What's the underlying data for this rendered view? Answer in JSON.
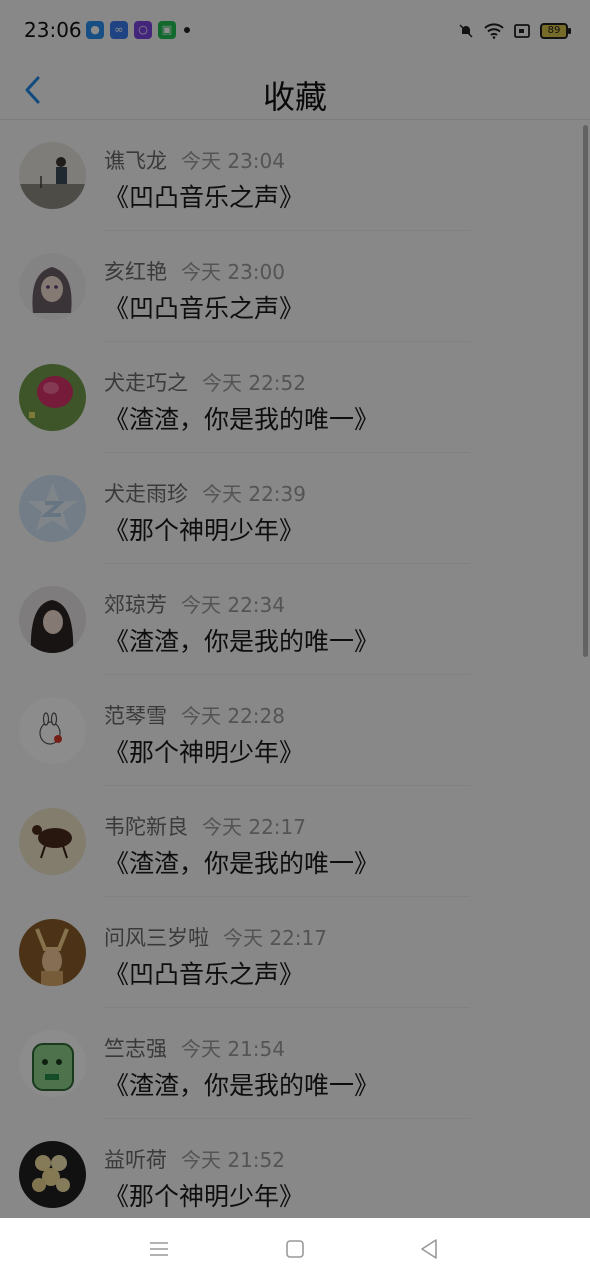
{
  "status_bar": {
    "time": "23:06",
    "battery": "89"
  },
  "header": {
    "title": "收藏"
  },
  "favorites": [
    {
      "name": "谯飞龙",
      "time": "今天 23:04",
      "title": "《凹凸音乐之声》"
    },
    {
      "name": "亥红艳",
      "time": "今天 23:00",
      "title": "《凹凸音乐之声》"
    },
    {
      "name": "犬走巧之",
      "time": "今天 22:52",
      "title": "《渣渣，你是我的唯一》"
    },
    {
      "name": "犬走雨珍",
      "time": "今天 22:39",
      "title": "《那个神明少年》"
    },
    {
      "name": "郊琼芳",
      "time": "今天 22:34",
      "title": "《渣渣，你是我的唯一》"
    },
    {
      "name": "范琴雪",
      "time": "今天 22:28",
      "title": "《那个神明少年》"
    },
    {
      "name": "韦陀新良",
      "time": "今天 22:17",
      "title": "《渣渣，你是我的唯一》"
    },
    {
      "name": "问风三岁啦",
      "time": "今天 22:17",
      "title": "《凹凸音乐之声》"
    },
    {
      "name": "竺志强",
      "time": "今天 21:54",
      "title": "《渣渣，你是我的唯一》"
    },
    {
      "name": "益听荷",
      "time": "今天 21:52",
      "title": "《那个神明少年》"
    }
  ],
  "colors": {
    "accent": "#1e88e5",
    "overlay": "rgba(0,0,0,0.45)"
  }
}
